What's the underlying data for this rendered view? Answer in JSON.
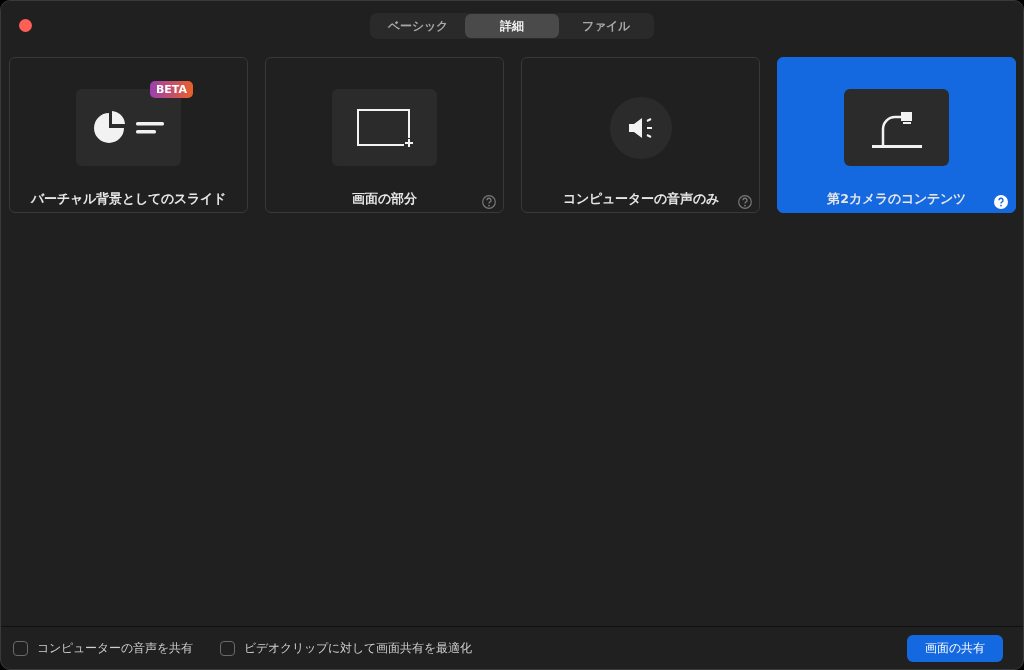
{
  "tabs": [
    {
      "label": "ベーシック",
      "selected": false
    },
    {
      "label": "詳細",
      "selected": true
    },
    {
      "label": "ファイル",
      "selected": false
    }
  ],
  "cards": [
    {
      "kind": "slides",
      "label": "バーチャル背景としてのスライド",
      "badge": "BETA",
      "help": false,
      "selected": false
    },
    {
      "kind": "portion",
      "label": "画面の部分",
      "help": true,
      "selected": false
    },
    {
      "kind": "audio",
      "label": "コンピューターの音声のみ",
      "help": true,
      "selected": false
    },
    {
      "kind": "camera",
      "label": "第2カメラのコンテンツ",
      "help": true,
      "selected": true
    }
  ],
  "options": [
    {
      "label": "コンピューターの音声を共有",
      "checked": false
    },
    {
      "label": "ビデオクリップに対して画面共有を最適化",
      "checked": false
    }
  ],
  "share_button": "画面の共有"
}
